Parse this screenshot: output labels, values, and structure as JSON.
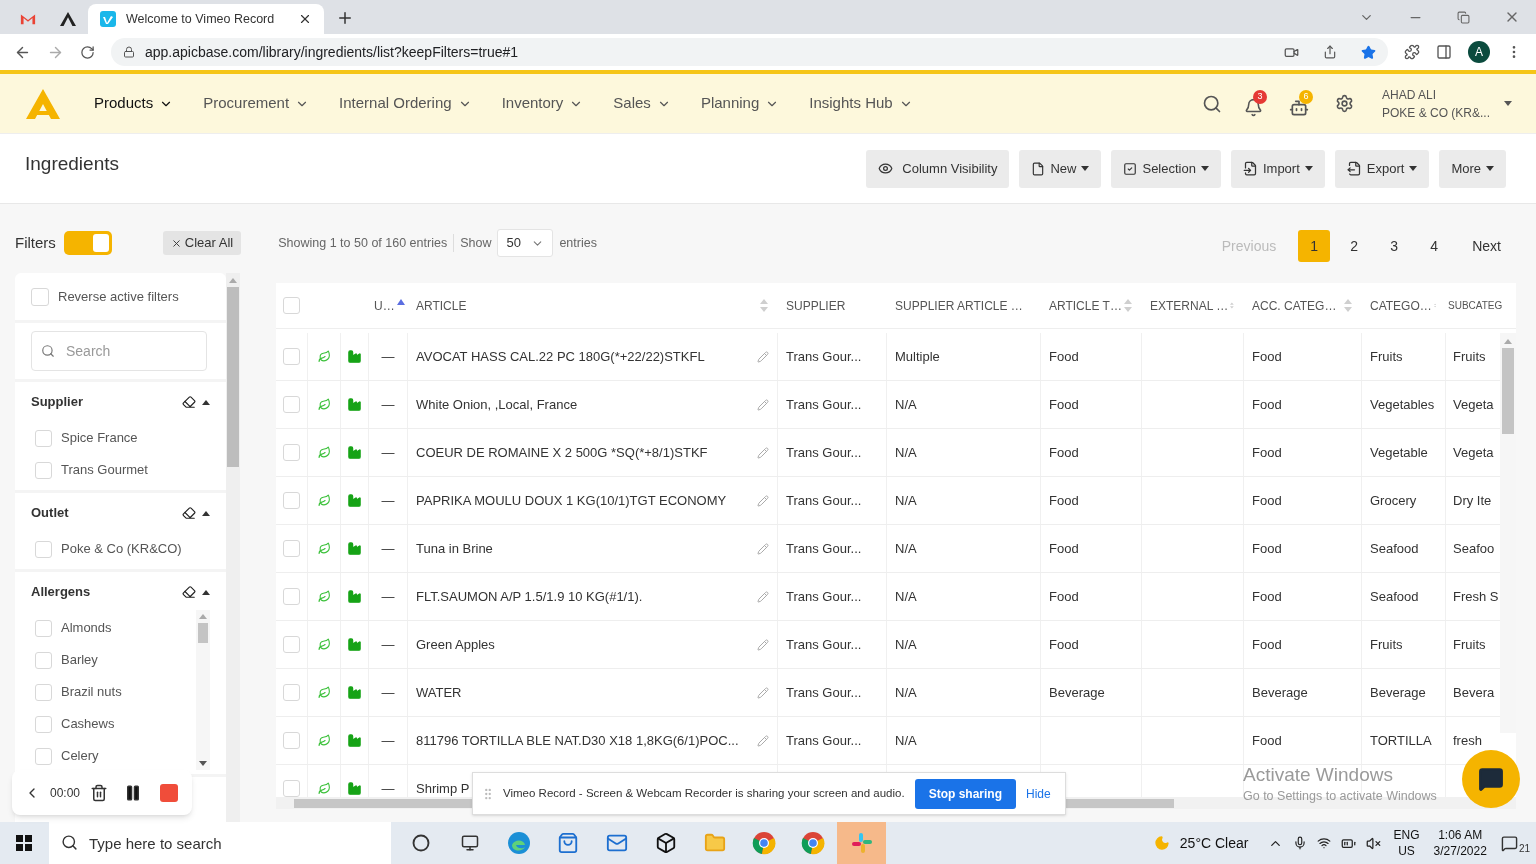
{
  "browser": {
    "tabs": [
      {
        "kind": "gmail",
        "selected": false
      },
      {
        "kind": "apicbase",
        "selected": false
      },
      {
        "kind": "vimeo",
        "title": "Welcome to Vimeo Record",
        "selected": true
      }
    ],
    "url": "app.apicbase.com/library/ingredients/list?keepFilters=true#1",
    "profile": "A"
  },
  "nav": {
    "items": [
      {
        "label": "Products",
        "selected": true
      },
      {
        "label": "Procurement",
        "selected": false
      },
      {
        "label": "Internal Ordering",
        "selected": false
      },
      {
        "label": "Inventory",
        "selected": false
      },
      {
        "label": "Sales",
        "selected": false
      },
      {
        "label": "Planning",
        "selected": false
      },
      {
        "label": "Insights Hub",
        "selected": false
      }
    ],
    "notifications": "3",
    "bot_badge": "6",
    "user": {
      "name": "AHAD ALI",
      "company": "POKE & CO (KR&..."
    }
  },
  "page": {
    "title": "Ingredients",
    "actions": [
      {
        "kind": "eye",
        "label": "Column Visibility",
        "caret": false
      },
      {
        "kind": "file",
        "label": "New",
        "caret": true
      },
      {
        "kind": "check",
        "label": "Selection",
        "caret": true
      },
      {
        "kind": "import",
        "label": "Import",
        "caret": true
      },
      {
        "kind": "export",
        "label": "Export",
        "caret": true
      },
      {
        "kind": "none",
        "label": "More",
        "caret": true
      }
    ]
  },
  "filters": {
    "label": "Filters",
    "on": true,
    "clear": "Clear All",
    "reverse": {
      "label": "Reverse active filters",
      "checked": false
    },
    "search_placeholder": "Search",
    "sections": [
      {
        "title": "Supplier",
        "expanded": true,
        "options": [
          {
            "label": "Spice France",
            "checked": false
          },
          {
            "label": "Trans Gourmet",
            "checked": false
          }
        ]
      },
      {
        "title": "Outlet",
        "expanded": true,
        "options": [
          {
            "label": "Poke & Co (KR&CO)",
            "checked": false
          }
        ]
      },
      {
        "title": "Allergens",
        "expanded": true,
        "scroll": true,
        "options": [
          {
            "label": "Almonds",
            "checked": false
          },
          {
            "label": "Barley",
            "checked": false
          },
          {
            "label": "Brazil nuts",
            "checked": false
          },
          {
            "label": "Cashews",
            "checked": false
          },
          {
            "label": "Celery",
            "checked": false
          }
        ]
      }
    ]
  },
  "table": {
    "info": "Showing 1 to 50 of 160 entries",
    "show": "Show",
    "page_size": "50",
    "entries": "entries",
    "pagination": {
      "previous": {
        "label": "Previous",
        "disabled": true
      },
      "pages": [
        {
          "label": "1",
          "selected": true
        },
        {
          "label": "2",
          "selected": false
        },
        {
          "label": "3",
          "selected": false
        },
        {
          "label": "4",
          "selected": false
        }
      ],
      "next": {
        "label": "Next",
        "disabled": false
      }
    },
    "all_selected": false,
    "columns": [
      {
        "label": "U…",
        "sortable": true,
        "sorted": true
      },
      {
        "label": "ARTICLE",
        "sortable": true,
        "sorted": false
      },
      {
        "label": "SUPPLIER",
        "sortable": false
      },
      {
        "label": "SUPPLIER ARTICLE …",
        "sortable": false
      },
      {
        "label": "ARTICLE T…",
        "sortable": true,
        "sorted": false
      },
      {
        "label": "EXTERNAL …",
        "sortable": true,
        "sorted": false
      },
      {
        "label": "ACC. CATEG…",
        "sortable": true,
        "sorted": false
      },
      {
        "label": "CATEGO…",
        "sortable": true,
        "sorted": false
      },
      {
        "label": "SUBCATEG",
        "sortable": false
      }
    ],
    "rows": [
      {
        "selected": false,
        "cells": [
          "—",
          "AVOCAT HASS CAL.22 PC 180G(*+22/22)STKFL",
          "Trans Gour...",
          "Multiple",
          "Food",
          "",
          "Food",
          "Fruits",
          "Fruits"
        ]
      },
      {
        "selected": false,
        "cells": [
          "—",
          "White Onion, ,Local, France",
          "Trans Gour...",
          "N/A",
          "Food",
          "",
          "Food",
          "Vegetables",
          "Vegeta"
        ]
      },
      {
        "selected": false,
        "cells": [
          "—",
          "COEUR DE ROMAINE X 2 500G *SQ(*+8/1)STKF",
          "Trans Gour...",
          "N/A",
          "Food",
          "",
          "Food",
          "Vegetable",
          "Vegeta"
        ]
      },
      {
        "selected": false,
        "cells": [
          "—",
          "PAPRIKA MOULU DOUX 1 KG(10/1)TGT ECONOMY",
          "Trans Gour...",
          "N/A",
          "Food",
          "",
          "Food",
          "Grocery",
          "Dry Ite"
        ]
      },
      {
        "selected": false,
        "cells": [
          "—",
          "Tuna in Brine",
          "Trans Gour...",
          "N/A",
          "Food",
          "",
          "Food",
          "Seafood",
          "Seafoo"
        ]
      },
      {
        "selected": false,
        "cells": [
          "—",
          "FLT.SAUMON A/P 1.5/1.9 10 KG(#1/1).",
          "Trans Gour...",
          "N/A",
          "Food",
          "",
          "Food",
          "Seafood",
          "Fresh S"
        ]
      },
      {
        "selected": false,
        "cells": [
          "—",
          "Green Apples",
          "Trans Gour...",
          "N/A",
          "Food",
          "",
          "Food",
          "Fruits",
          "Fruits"
        ]
      },
      {
        "selected": false,
        "cells": [
          "—",
          "WATER",
          "Trans Gour...",
          "N/A",
          "Beverage",
          "",
          "Beverage",
          "Beverage",
          "Bevera"
        ]
      },
      {
        "selected": false,
        "cells": [
          "—",
          "811796 TORTILLA BLE NAT.D30 X18 1,8KG(6/1)POC...",
          "Trans Gour...",
          "N/A",
          "",
          "",
          "Food",
          "TORTILLA",
          "fresh"
        ]
      },
      {
        "selected": false,
        "cells": [
          "—",
          "Shrimp P",
          "",
          "",
          "",
          "",
          "",
          "",
          ""
        ]
      }
    ]
  },
  "recorder": {
    "time": "00:00"
  },
  "activation": {
    "title": "Activate Windows",
    "subtitle": "Go to Settings to activate Windows"
  },
  "share_bar": {
    "message": "Vimeo Record - Screen & Webcam Recorder is sharing your screen and audio.",
    "stop": "Stop sharing",
    "hide": "Hide"
  },
  "taskbar": {
    "search_placeholder": "Type here to search",
    "apps": [
      {
        "kind": "cortana",
        "selected": false
      },
      {
        "kind": "taskview",
        "selected": false
      },
      {
        "kind": "edge",
        "selected": false
      },
      {
        "kind": "store",
        "selected": false
      },
      {
        "kind": "mail",
        "selected": false
      },
      {
        "kind": "dropbox",
        "selected": false
      },
      {
        "kind": "explorer",
        "selected": false
      },
      {
        "kind": "chrome",
        "selected": false
      },
      {
        "kind": "chrome",
        "selected": false
      },
      {
        "kind": "slack",
        "selected": true
      }
    ],
    "weather": "25°C Clear",
    "lang": "ENG",
    "region": "US",
    "time": "1:06 AM",
    "date": "3/27/2022",
    "notifications": "21"
  }
}
